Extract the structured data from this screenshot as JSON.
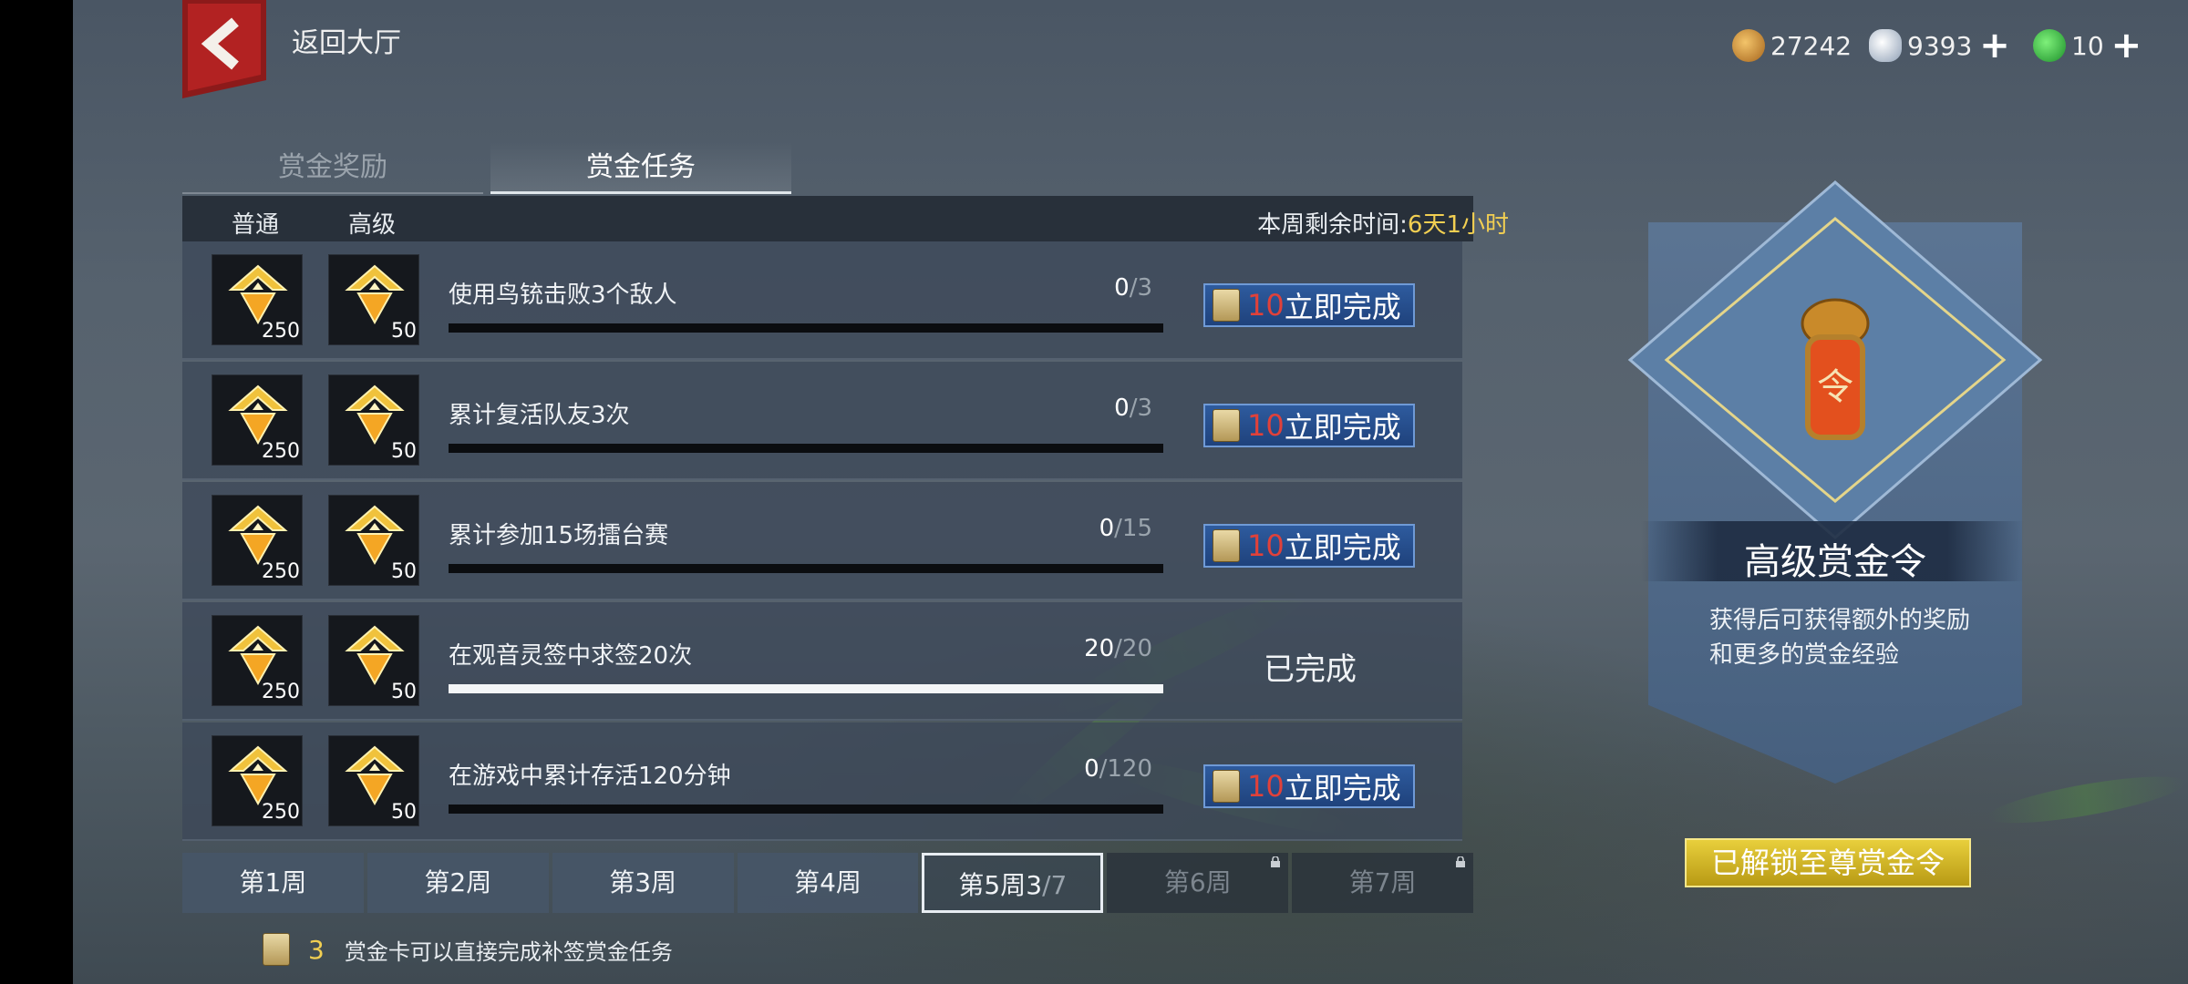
{
  "header": {
    "back_label": "返回大厅",
    "currencies": [
      {
        "icon": "copper-coin-icon",
        "value": "27242",
        "has_plus": false
      },
      {
        "icon": "silver-ingot-icon",
        "value": "9393",
        "has_plus": true
      },
      {
        "icon": "jade-icon",
        "value": "10",
        "has_plus": true
      }
    ]
  },
  "tabs": [
    "赏金奖励",
    "赏金任务"
  ],
  "active_tab": "赏金任务",
  "table_header": {
    "normal": "普通",
    "advanced": "高级",
    "time_label": "本周剩余时间:",
    "time_value": "6天1小时"
  },
  "tasks": [
    {
      "name": "使用鸟铳击败3个敌人",
      "current": "0",
      "total": "/3",
      "progress": 0,
      "normal_reward": "250",
      "advanced_reward": "50",
      "status": "incomplete",
      "cost": "10",
      "action": "立即完成"
    },
    {
      "name": "累计复活队友3次",
      "current": "0",
      "total": "/3",
      "progress": 0,
      "normal_reward": "250",
      "advanced_reward": "50",
      "status": "incomplete",
      "cost": "10",
      "action": "立即完成"
    },
    {
      "name": "累计参加15场擂台赛",
      "current": "0",
      "total": "/15",
      "progress": 0,
      "normal_reward": "250",
      "advanced_reward": "50",
      "status": "incomplete",
      "cost": "10",
      "action": "立即完成"
    },
    {
      "name": "在观音灵签中求签20次",
      "current": "20",
      "total": "/20",
      "progress": 1,
      "normal_reward": "250",
      "advanced_reward": "50",
      "status": "done",
      "done_label": "已完成"
    },
    {
      "name": "在游戏中累计存活120分钟",
      "current": "0",
      "total": "/120",
      "progress": 0,
      "normal_reward": "250",
      "advanced_reward": "50",
      "status": "incomplete",
      "cost": "10",
      "action": "立即完成"
    }
  ],
  "weeks": [
    {
      "label": "第1周",
      "state": "normal"
    },
    {
      "label": "第2周",
      "state": "normal"
    },
    {
      "label": "第3周",
      "state": "normal"
    },
    {
      "label": "第4周",
      "state": "normal"
    },
    {
      "label": "第5周",
      "state": "active",
      "progress_cur": "3",
      "progress_tot": "/7"
    },
    {
      "label": "第6周",
      "state": "locked"
    },
    {
      "label": "第7周",
      "state": "locked"
    }
  ],
  "footer_note": {
    "count": "3",
    "text": "赏金卡可以直接完成补签赏金任务"
  },
  "side_card": {
    "title": "高级赏金令",
    "emblem_char": "令",
    "description": "获得后可获得额外的奖励和更多的赏金经验",
    "button": "已解锁至尊赏金令"
  },
  "colors": {
    "accent_gold": "#f2cf52",
    "cost_red": "#e0413a",
    "button_blue": "#2e5b9e",
    "unlock_gold": "#d4b52a"
  }
}
